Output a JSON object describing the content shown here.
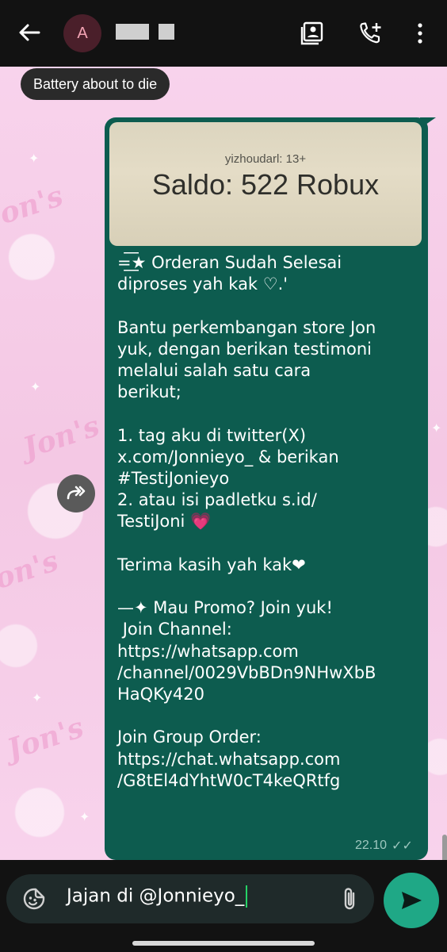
{
  "header": {
    "avatar_letter": "A",
    "toast": "Battery about to die"
  },
  "message": {
    "image": {
      "username": "yizhoudarl: 13+",
      "caption": "Saldo: 522 Robux"
    },
    "text": "=͟͟͞͞★ Orderan Sudah Selesai\ndiproses yah kak ♡.'\n\nBantu perkembangan store Jon\nyuk, dengan berikan testimoni\nmelalui salah satu cara\nberikut;\n\n1. tag aku di twitter(X)\nx.com/Jonnieyo_ & berikan\n#TestiJonieyo\n2. atau isi padletku s.id/\nTestiJoni 💗\n\nTerima kasih yah kak❤\n\n—✦ Mau Promo? Join yuk!\n Join Channel:\nhttps://whatsapp.com\n/channel/0029VbBDn9NHwXbB\nHaQKy420\n\nJoin Group Order:\nhttps://chat.whatsapp.com\n/G8tEl4dYhtW0cT4keQRtfg",
    "time": "22.10",
    "status": "✓✓"
  },
  "composer": {
    "text": "Jajan di @Jonnieyo_"
  },
  "wallpaper": {
    "text": "Jon's"
  },
  "colors": {
    "bubble": "#0d5c4f",
    "send_button": "#1fa886",
    "wallpaper": "#f6cde8"
  }
}
